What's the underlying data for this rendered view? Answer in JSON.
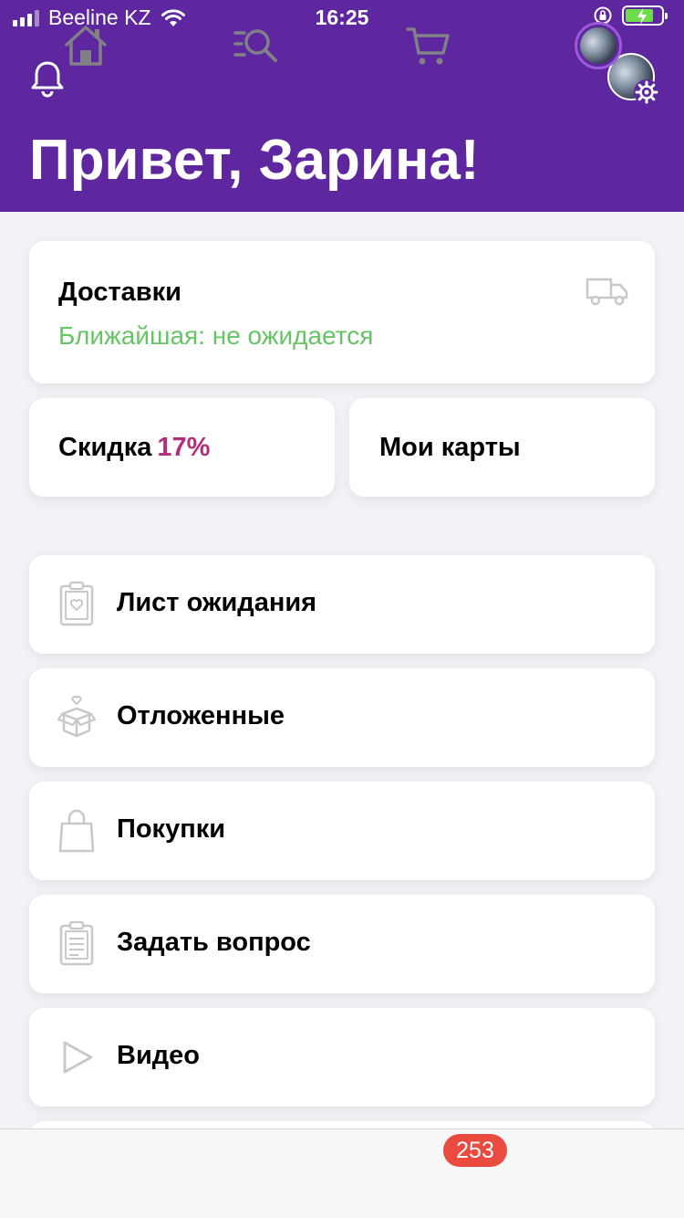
{
  "status_bar": {
    "carrier": "Beeline KZ",
    "time": "16:25",
    "battery_state": "charging"
  },
  "header": {
    "greeting": "Привет, Зарина!",
    "bell_icon": "bell-icon",
    "profile_icon": "avatar-with-gear-icon",
    "background_color": "#5e27a0"
  },
  "delivery": {
    "title": "Доставки",
    "subtitle": "Ближайшая: не ожидается",
    "subtitle_color": "#66c466",
    "icon": "truck-icon"
  },
  "discount": {
    "label": "Скидка",
    "value": "17%",
    "value_color": "#b32d7a"
  },
  "my_cards": {
    "label": "Мои карты"
  },
  "menu": [
    {
      "label": "Лист ожидания",
      "icon": "clipboard-heart-icon"
    },
    {
      "label": "Отложенные",
      "icon": "box-heart-icon"
    },
    {
      "label": "Покупки",
      "icon": "shopping-bag-icon"
    },
    {
      "label": "Задать вопрос",
      "icon": "clipboard-lines-icon"
    },
    {
      "label": "Видео",
      "icon": "play-icon"
    }
  ],
  "tab_bar": {
    "tabs": [
      {
        "name": "home",
        "icon": "home-icon"
      },
      {
        "name": "catalog-search",
        "icon": "search-list-icon"
      },
      {
        "name": "cart",
        "icon": "cart-icon"
      },
      {
        "name": "profile",
        "icon": "avatar-icon",
        "active": true
      }
    ],
    "cart_count": "253",
    "badge_color": "#eb4b3f"
  }
}
